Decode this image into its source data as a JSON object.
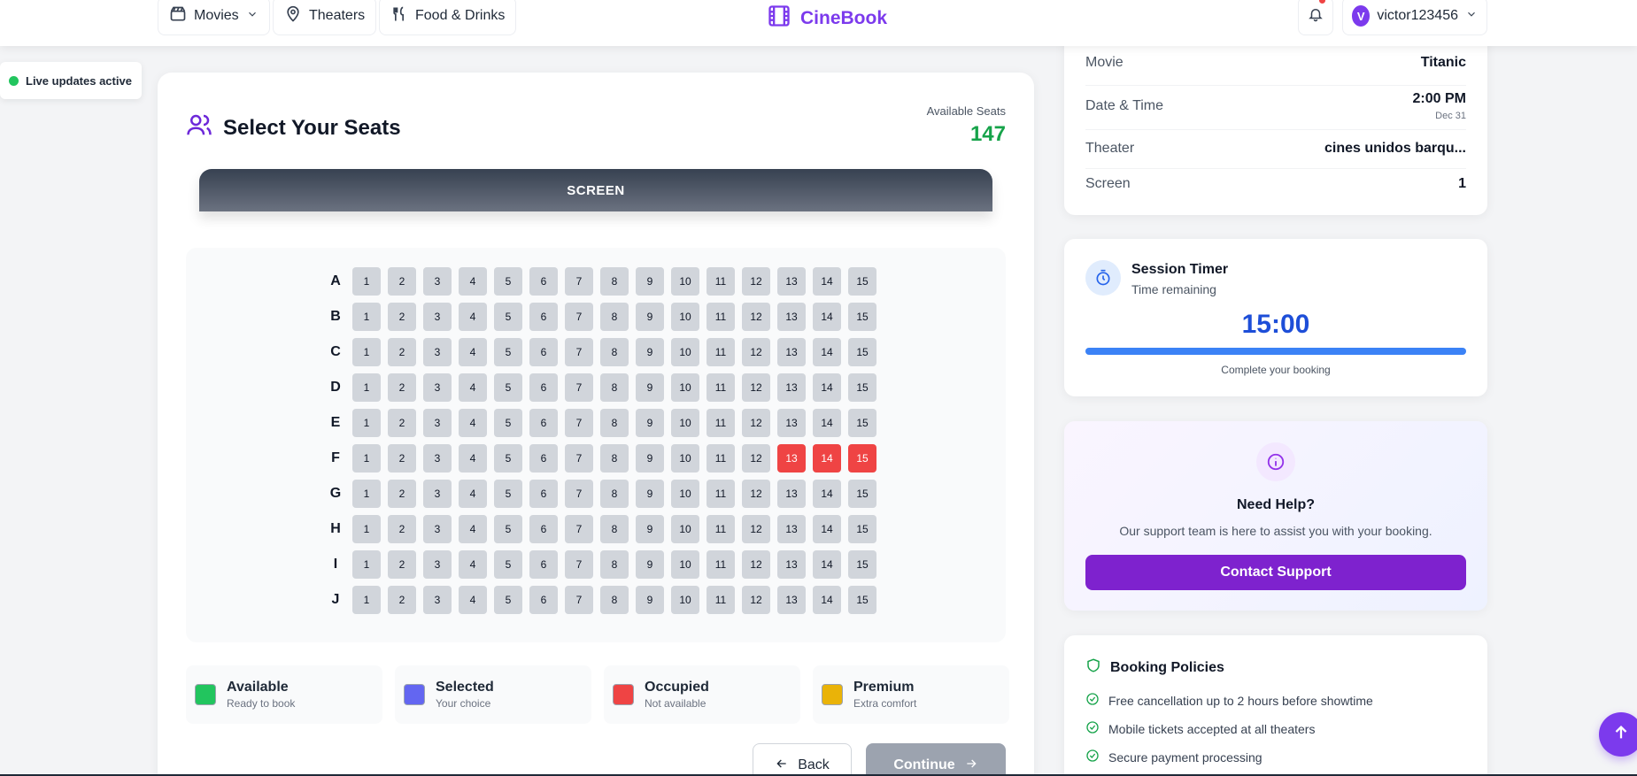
{
  "nav": {
    "movies": "Movies",
    "theaters": "Theaters",
    "food": "Food & Drinks",
    "brand": "CineBook",
    "user": "victor123456",
    "avatar_letter": "V"
  },
  "live_status": "Live updates active",
  "seat_selection": {
    "title": "Select Your Seats",
    "available_label": "Available Seats",
    "available_count": "147",
    "screen_label": "SCREEN",
    "rows": [
      "A",
      "B",
      "C",
      "D",
      "E",
      "F",
      "G",
      "H",
      "I",
      "J"
    ],
    "seats_per_row": 15,
    "occupied": [
      "F13",
      "F14",
      "F15"
    ],
    "legend": [
      {
        "title": "Available",
        "subtitle": "Ready to book",
        "color": "#22c55e"
      },
      {
        "title": "Selected",
        "subtitle": "Your choice",
        "color": "#6366f1"
      },
      {
        "title": "Occupied",
        "subtitle": "Not available",
        "color": "#ef4444"
      },
      {
        "title": "Premium",
        "subtitle": "Extra comfort",
        "color": "#eab308"
      }
    ],
    "back_label": "Back",
    "continue_label": "Continue"
  },
  "summary": {
    "movie_label": "Movie",
    "movie_value": "Titanic",
    "datetime_label": "Date & Time",
    "time_value": "2:00 PM",
    "date_value": "Dec 31",
    "theater_label": "Theater",
    "theater_value": "cines unidos barqu...",
    "screen_label": "Screen",
    "screen_value": "1"
  },
  "timer": {
    "title": "Session Timer",
    "subtitle": "Time remaining",
    "value": "15:00",
    "progress": 1.0,
    "note": "Complete your booking"
  },
  "help": {
    "title": "Need Help?",
    "text": "Our support team is here to assist you with your booking.",
    "button": "Contact Support"
  },
  "policies": {
    "title": "Booking Policies",
    "items": [
      "Free cancellation up to 2 hours before showtime",
      "Mobile tickets accepted at all theaters",
      "Secure payment processing"
    ]
  }
}
